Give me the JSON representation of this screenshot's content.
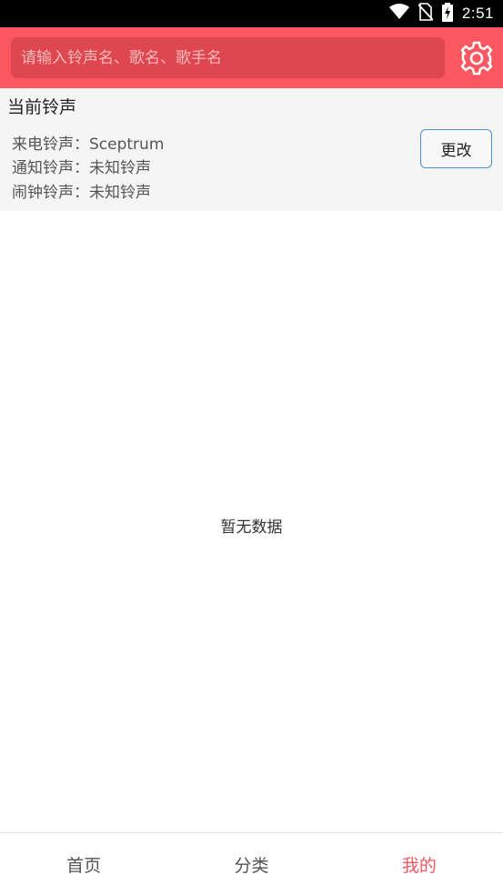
{
  "status_bar": {
    "time": "2:51"
  },
  "search": {
    "placeholder": "请输入铃声名、歌名、歌手名",
    "value": ""
  },
  "current_ringtone": {
    "title": "当前铃声",
    "rows": [
      {
        "label": "来电铃声：",
        "value": "Sceptrum"
      },
      {
        "label": "通知铃声：",
        "value": "未知铃声"
      },
      {
        "label": "闹钟铃声：",
        "value": "未知铃声"
      }
    ],
    "change_label": "更改"
  },
  "empty_state": "暂无数据",
  "bottom_nav": {
    "items": [
      {
        "label": "首页"
      },
      {
        "label": "分类"
      },
      {
        "label": "我的"
      }
    ],
    "active_index": 2
  },
  "colors": {
    "accent": "#fb5761",
    "search_bg": "#de474f",
    "button_border": "#4a90d9"
  },
  "icons": [
    "wifi-icon",
    "no-sim-icon",
    "battery-charging-icon",
    "settings-gear-icon"
  ]
}
